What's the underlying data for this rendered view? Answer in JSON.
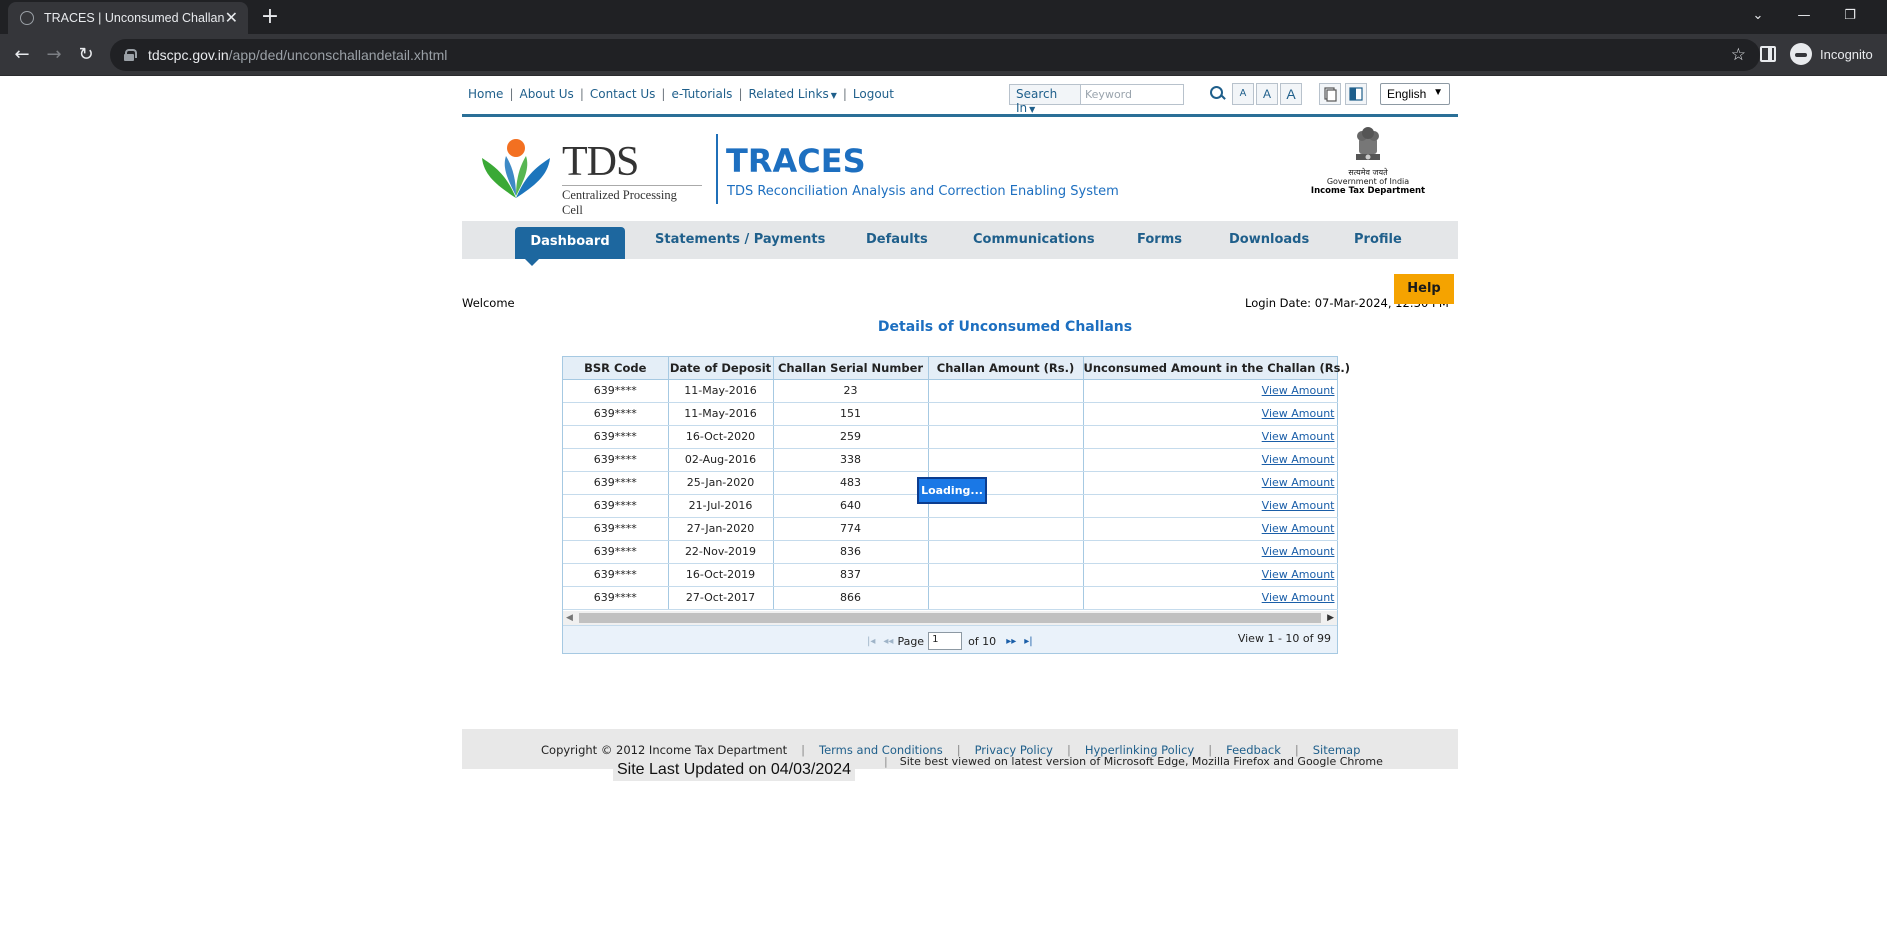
{
  "browser": {
    "tab_title": "TRACES | Unconsumed Challans",
    "url_host": "tdscpc.gov.in",
    "url_path": "/app/ded/unconschallandetail.xhtml",
    "profile_label": "Incognito"
  },
  "topnav": {
    "links": [
      "Home",
      "About Us",
      "Contact Us",
      "e-Tutorials",
      "Related Links",
      "Logout"
    ],
    "search_in": "Search In",
    "keyword_placeholder": "Keyword",
    "font_sizes": [
      "A",
      "A",
      "A"
    ],
    "language": "English"
  },
  "header": {
    "logo_text": "TDS",
    "logo_sub": "Centralized Processing Cell",
    "title": "TRACES",
    "subtitle": "TDS Reconciliation Analysis and Correction Enabling System",
    "emblem_hindi": "सत्यमेव जयते",
    "emblem_goi": "Government of India",
    "emblem_itd": "Income Tax Department"
  },
  "mainnav": {
    "active": "Dashboard",
    "items": [
      "Statements / Payments",
      "Defaults",
      "Communications",
      "Forms",
      "Downloads",
      "Profile"
    ]
  },
  "help_label": "Help",
  "welcome": "Welcome",
  "login_date": "Login Date: 07-Mar-2024, 12:30 PM",
  "page_title": "Details of Unconsumed Challans",
  "grid": {
    "columns": [
      "BSR Code",
      "Date of Deposit",
      "Challan Serial Number",
      "Challan Amount (Rs.)",
      "Unconsumed Amount in the Challan (Rs.)"
    ],
    "link_label": "View Amount",
    "rows": [
      {
        "bsr": "639****",
        "date": "11-May-2016",
        "serial": "23",
        "amount": ""
      },
      {
        "bsr": "639****",
        "date": "11-May-2016",
        "serial": "151",
        "amount": ""
      },
      {
        "bsr": "639****",
        "date": "16-Oct-2020",
        "serial": "259",
        "amount": ""
      },
      {
        "bsr": "639****",
        "date": "02-Aug-2016",
        "serial": "338",
        "amount": ""
      },
      {
        "bsr": "639****",
        "date": "25-Jan-2020",
        "serial": "483",
        "amount": ""
      },
      {
        "bsr": "639****",
        "date": "21-Jul-2016",
        "serial": "640",
        "amount": ""
      },
      {
        "bsr": "639****",
        "date": "27-Jan-2020",
        "serial": "774",
        "amount": ""
      },
      {
        "bsr": "639****",
        "date": "22-Nov-2019",
        "serial": "836",
        "amount": ""
      },
      {
        "bsr": "639****",
        "date": "16-Oct-2019",
        "serial": "837",
        "amount": ""
      },
      {
        "bsr": "639****",
        "date": "27-Oct-2017",
        "serial": "866",
        "amount": ""
      }
    ],
    "pager": {
      "page_label": "Page",
      "current_page": "1",
      "of_label": "of 10",
      "view_label": "View 1 - 10 of 99"
    },
    "loading_label": "Loading..."
  },
  "footer": {
    "copyright": "Copyright © 2012 Income Tax Department",
    "links": [
      "Terms and Conditions",
      "Privacy Policy",
      "Hyperlinking Policy",
      "Feedback",
      "Sitemap"
    ],
    "best_viewed": "Site best viewed on latest version of Microsoft Edge, Mozilla Firefox and Google Chrome",
    "last_updated": "Site Last Updated on 04/03/2024"
  }
}
